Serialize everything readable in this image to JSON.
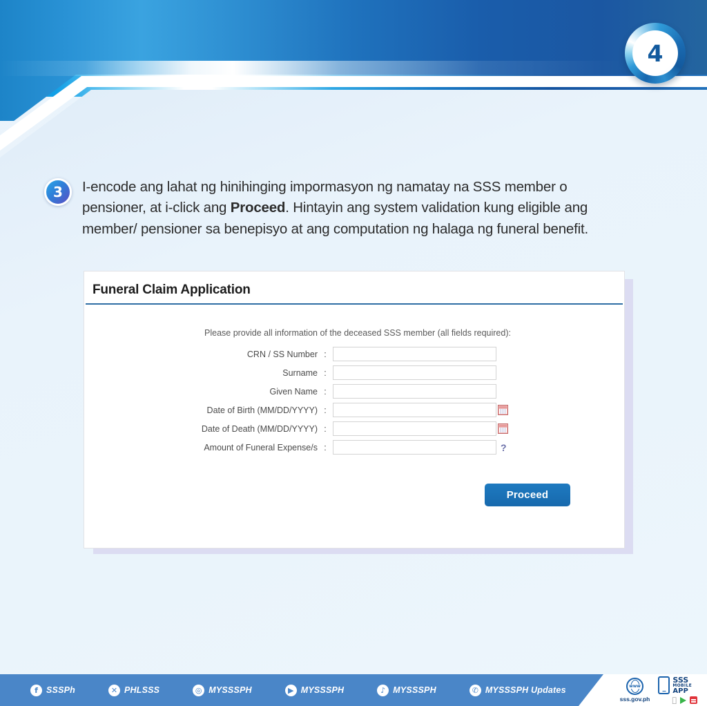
{
  "page": {
    "number_badge": "4",
    "background_color": "#e9f3fb",
    "banner_color": "#1f72bd"
  },
  "step": {
    "number": "3",
    "text_line1": "I-encode ang lahat ng hinihinging impormasyon ng namatay na SSS member o pensioner,",
    "text_line2_before": "at i-click ang ",
    "text_bold": "Proceed",
    "text_line2_after": ". Hintayin ang system validation kung eligible ang member/",
    "text_line3": "pensioner sa benepisyo at ang computation ng halaga ng funeral benefit."
  },
  "form": {
    "title": "Funeral Claim Application",
    "intro": "Please provide all information of the deceased SSS member (all fields required):",
    "colon": ":",
    "fields": [
      {
        "label": "CRN / SS Number",
        "value": "",
        "placeholder": "",
        "icon": "none"
      },
      {
        "label": "Surname",
        "value": "",
        "placeholder": "",
        "icon": "none"
      },
      {
        "label": "Given Name",
        "value": "",
        "placeholder": "",
        "icon": "none"
      },
      {
        "label": "Date of Birth (MM/DD/YYYY)",
        "value": "",
        "placeholder": "",
        "icon": "calendar-icon"
      },
      {
        "label": "Date of Death (MM/DD/YYYY)",
        "value": "",
        "placeholder": "",
        "icon": "calendar-icon"
      },
      {
        "label": "Amount of Funeral Expense/s",
        "value": "",
        "placeholder": "",
        "icon": "help-icon"
      }
    ],
    "help_glyph": "?",
    "submit_label": "Proceed",
    "submit_color": "#1769ad"
  },
  "footer": {
    "background_color": "#4a86c8",
    "socials": [
      {
        "icon": "facebook-icon",
        "glyph": "f",
        "label": "SSSPh"
      },
      {
        "icon": "x-twitter-icon",
        "glyph": "✕",
        "label": "PHLSSS"
      },
      {
        "icon": "instagram-icon",
        "glyph": "◎",
        "label": "MYSSSPH"
      },
      {
        "icon": "youtube-icon",
        "glyph": "▶",
        "label": "MYSSSPH"
      },
      {
        "icon": "tiktok-icon",
        "glyph": "♪",
        "label": "MYSSSPH"
      },
      {
        "icon": "viber-icon",
        "glyph": "✆",
        "label": "MYSSSPH Updates"
      }
    ],
    "website": {
      "icon": "globe-icon",
      "globe_text": "www",
      "label": "sss.gov.ph"
    },
    "mobile_app": {
      "icon": "phone-icon",
      "line1": "SSS",
      "line2": "MOBILE",
      "line3": "APP",
      "stores": [
        {
          "icon": "apple-appstore-icon",
          "glyph": ""
        },
        {
          "icon": "google-play-icon",
          "glyph": "▶"
        },
        {
          "icon": "huawei-appgallery-icon",
          "glyph": ""
        }
      ]
    }
  }
}
